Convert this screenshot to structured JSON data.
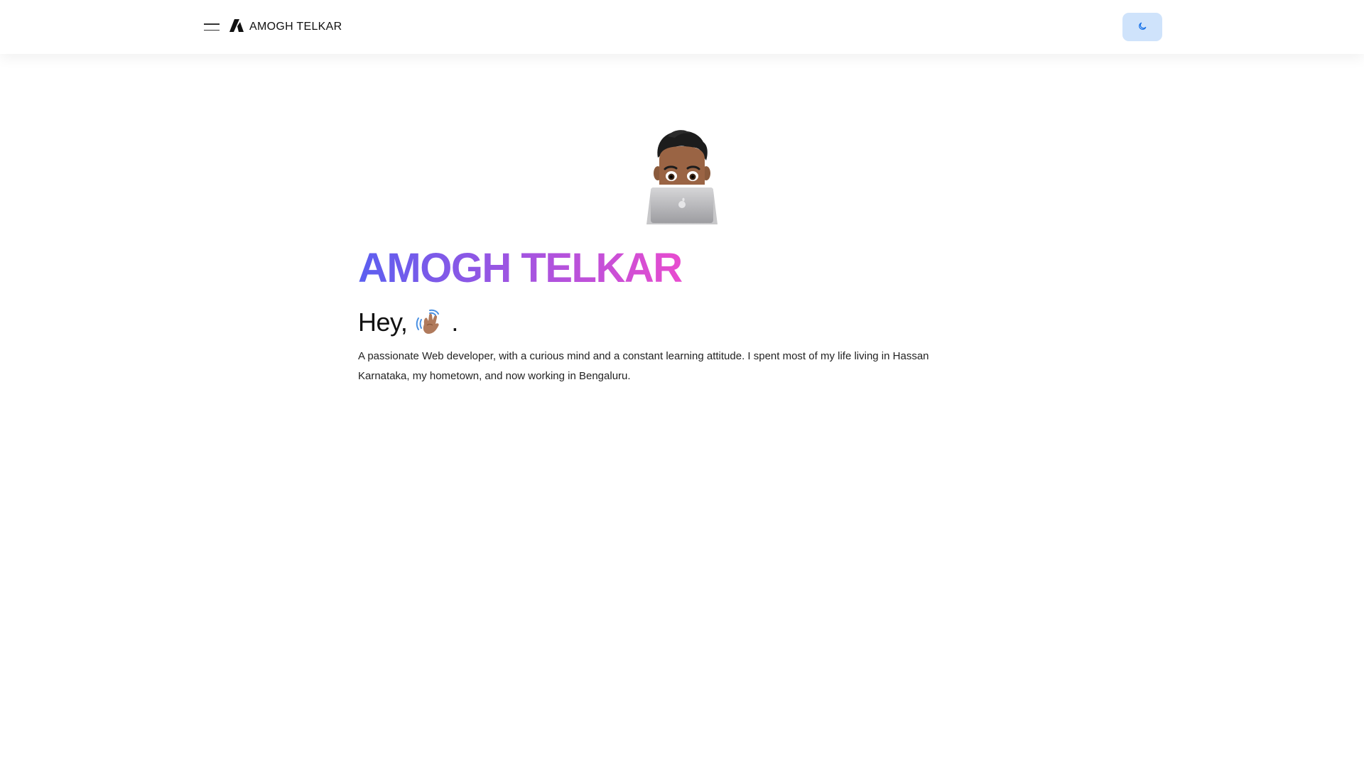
{
  "header": {
    "brand_name": "AMOGH TELKAR",
    "menu_icon": "hamburger-icon",
    "logo_icon": "triangle-logo-icon",
    "theme_toggle_icon": "moon-icon"
  },
  "hero": {
    "avatar": "memoji-laptop-avatar",
    "title": "AMOGH TELKAR",
    "greeting_prefix": "Hey,",
    "greeting_emoji": "waving-hand-icon",
    "greeting_suffix": ".",
    "intro": "A passionate Web developer, with a curious mind and a constant learning attitude. I spent most of my life living in Hassan Karnataka, my hometown, and now working in Bengaluru."
  },
  "colors": {
    "gradient_start": "#5b5ff0",
    "gradient_mid": "#9b55e2",
    "gradient_end": "#e84ccf",
    "theme_button_bg": "#cfe3fb",
    "theme_icon": "#1a73e8"
  }
}
